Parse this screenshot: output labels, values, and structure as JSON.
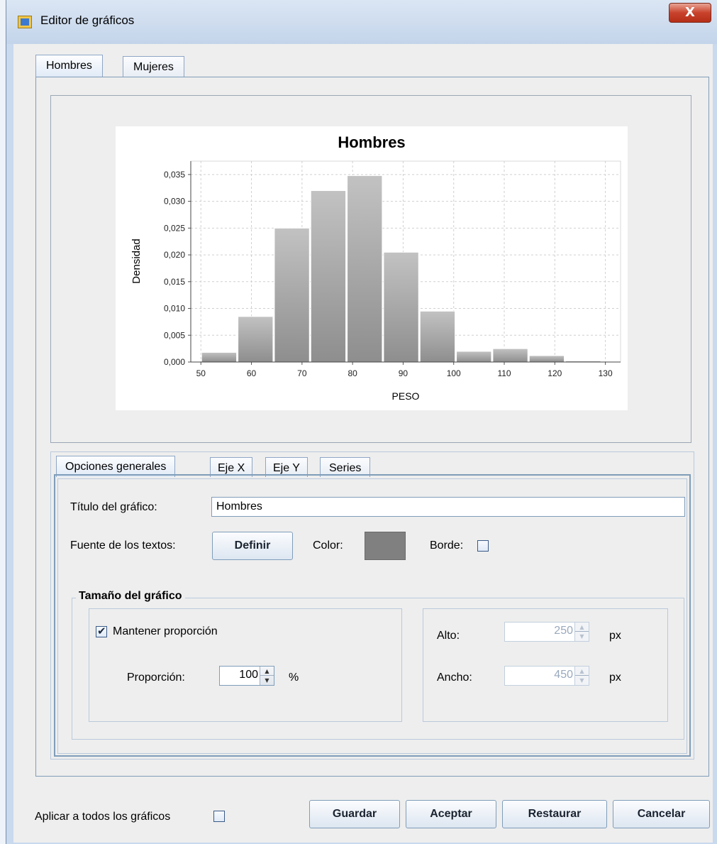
{
  "window": {
    "title": "Editor de gráficos",
    "close_label": "X"
  },
  "top_tabs": [
    {
      "label": "Hombres",
      "active": true
    },
    {
      "label": "Mujeres",
      "active": false
    }
  ],
  "chart_data": {
    "type": "bar",
    "title": "Hombres",
    "xlabel": "PESO",
    "ylabel": "Densidad",
    "x_ticks": [
      "50",
      "60",
      "70",
      "80",
      "90",
      "100",
      "110",
      "120",
      "130"
    ],
    "y_ticks": [
      "0,000",
      "0,005",
      "0,010",
      "0,015",
      "0,020",
      "0,025",
      "0,030",
      "0,035"
    ],
    "xlim": [
      48,
      133
    ],
    "ylim": [
      0,
      0.0375
    ],
    "bins": [
      {
        "x0": 50.0,
        "x1": 57.2,
        "value": 0.0018
      },
      {
        "x0": 57.2,
        "x1": 64.4,
        "value": 0.0085
      },
      {
        "x0": 64.4,
        "x1": 71.6,
        "value": 0.025
      },
      {
        "x0": 71.6,
        "x1": 78.8,
        "value": 0.032
      },
      {
        "x0": 78.8,
        "x1": 86.0,
        "value": 0.0348
      },
      {
        "x0": 86.0,
        "x1": 93.2,
        "value": 0.0205
      },
      {
        "x0": 93.2,
        "x1": 100.4,
        "value": 0.0095
      },
      {
        "x0": 100.4,
        "x1": 107.6,
        "value": 0.002
      },
      {
        "x0": 107.6,
        "x1": 114.8,
        "value": 0.0025
      },
      {
        "x0": 114.8,
        "x1": 122.0,
        "value": 0.0012
      },
      {
        "x0": 122.0,
        "x1": 129.2,
        "value": 0.0002
      }
    ],
    "grid": true,
    "bar_color": "#a8a8a8"
  },
  "sub_tabs": [
    {
      "label": "Opciones generales",
      "active": true
    },
    {
      "label": "Eje X",
      "active": false
    },
    {
      "label": "Eje Y",
      "active": false
    },
    {
      "label": "Series",
      "active": false
    }
  ],
  "general": {
    "title_label": "Título del gráfico:",
    "title_value": "Hombres",
    "font_label": "Fuente de los textos:",
    "define_button": "Definir",
    "color_label": "Color:",
    "color_value": "#808080",
    "border_label": "Borde:",
    "border_checked": false
  },
  "size_group": {
    "title": "Tamaño del gráfico",
    "keep_ratio_label": "Mantener proporción",
    "keep_ratio_checked": true,
    "ratio_label": "Proporción:",
    "ratio_value": "100",
    "ratio_unit": "%",
    "height_label": "Alto:",
    "height_value": "250",
    "height_unit": "px",
    "width_label": "Ancho:",
    "width_value": "450",
    "width_unit": "px"
  },
  "footer": {
    "apply_all_label": "Aplicar a todos los gráficos",
    "apply_all_checked": false,
    "save_button": "Guardar",
    "accept_button": "Aceptar",
    "restore_button": "Restaurar",
    "cancel_button": "Cancelar"
  }
}
